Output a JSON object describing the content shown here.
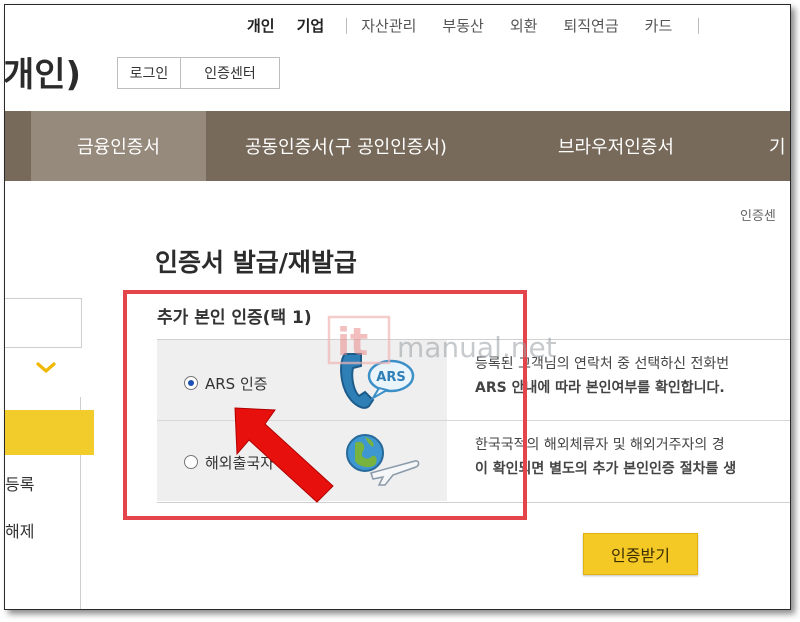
{
  "topnav": {
    "personal": "개인",
    "corporate": "기업",
    "links": [
      "자산관리",
      "부동산",
      "외환",
      "퇴직연금",
      "카드"
    ]
  },
  "brand": {
    "title": "개인)"
  },
  "header_buttons": {
    "login": "로그인",
    "cert_center": "인증센터"
  },
  "mainnav": {
    "items": [
      "금융인증서",
      "공동인증서(구 공인인증서)",
      "브라우저인증서",
      "기"
    ],
    "active_index": 0
  },
  "breadcrumb": "인증센",
  "page": {
    "title": "인증서 발급/재발급",
    "subtitle": "추가 본인 인증(택 1)"
  },
  "sidebar": {
    "items": [
      "등록",
      "해제"
    ]
  },
  "options": [
    {
      "label": "ARS 인증",
      "selected": true,
      "icon": "phone-ars-icon",
      "icon_text": "ARS",
      "desc_line1": "등록된 고객님의 연락처 중 선택하신 전화번",
      "desc_line2": "ARS 안내에 따라 본인여부를 확인합니다."
    },
    {
      "label": "해외출국자",
      "selected": false,
      "icon": "globe-airplane-icon",
      "desc_line1": "한국국적의 해외체류자 및 해외거주자의 경",
      "desc_line2": "이 확인되면 별도의 추가 본인인증 절차를 생"
    }
  ],
  "cta": {
    "label": "인증받기"
  },
  "watermark": {
    "badge": "it",
    "text": "manual.net"
  },
  "colors": {
    "nav_bg": "#776a5b",
    "nav_active": "#968a7d",
    "accent_yellow": "#f4c825",
    "annotation_red": "#e4454a",
    "radio_blue": "#1e4fb5"
  }
}
